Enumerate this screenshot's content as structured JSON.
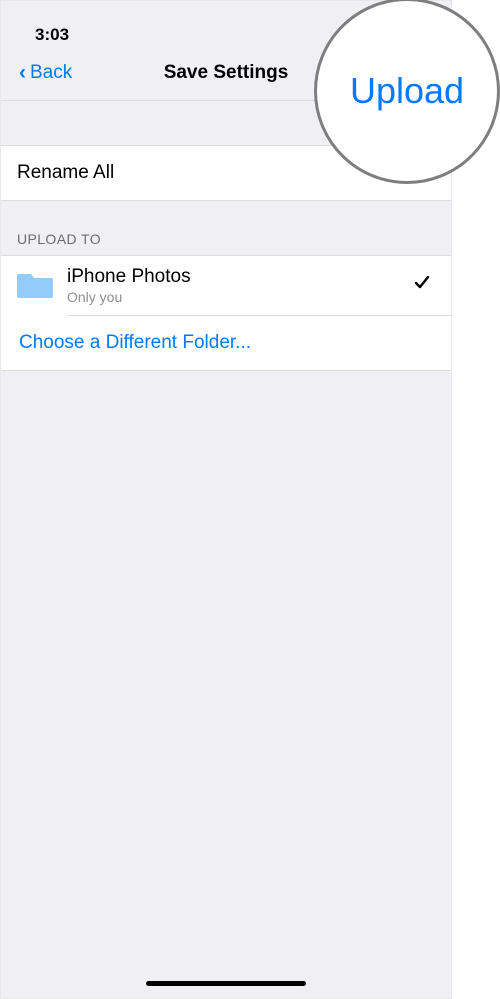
{
  "statusbar": {
    "time": "3:03"
  },
  "navbar": {
    "back_label": "Back",
    "title": "Save Settings",
    "upload_label": "Upload"
  },
  "rows": {
    "rename_all": "Rename All"
  },
  "section": {
    "upload_to": "UPLOAD TO"
  },
  "folder": {
    "name": "iPhone Photos",
    "subtitle": "Only you",
    "selected": true
  },
  "choose_folder": "Choose a Different Folder...",
  "zoom": {
    "label": "Upload"
  }
}
